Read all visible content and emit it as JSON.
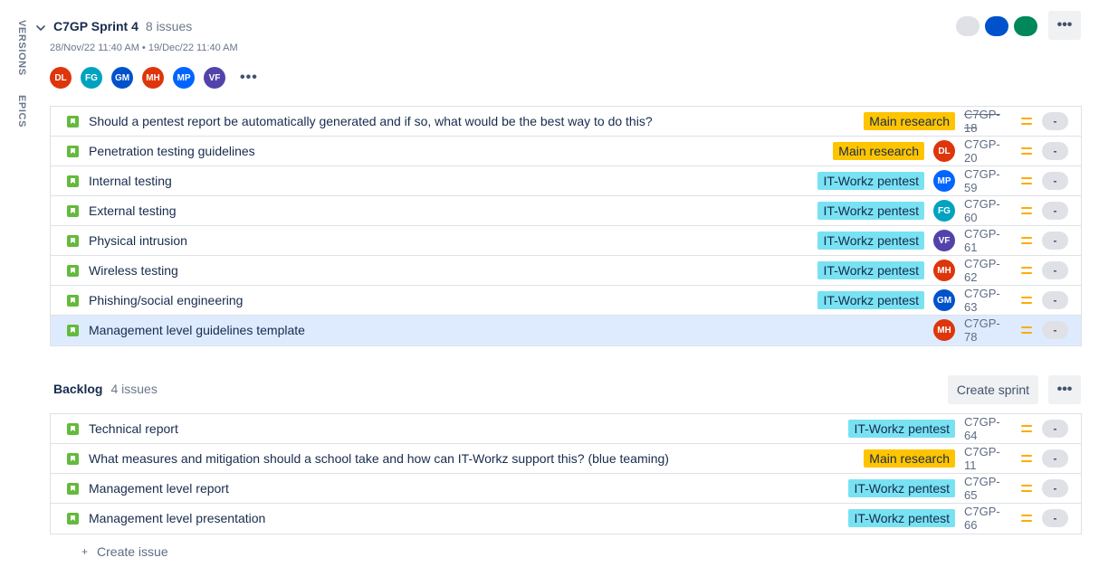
{
  "side_tabs": {
    "versions": "VERSIONS",
    "epics": "EPICS"
  },
  "sprint": {
    "title": "C7GP Sprint 4",
    "count": "8 issues",
    "dates": "28/Nov/22 11:40 AM • 19/Dec/22 11:40 AM",
    "more_label": "•••",
    "avatars": [
      {
        "initials": "DL",
        "color": "#de350b"
      },
      {
        "initials": "FG",
        "color": "#00a3bf"
      },
      {
        "initials": "GM",
        "color": "#0052cc"
      },
      {
        "initials": "MH",
        "color": "#de350b"
      },
      {
        "initials": "MP",
        "color": "#0065ff"
      },
      {
        "initials": "VF",
        "color": "#5243aa"
      }
    ],
    "status_pills": [
      "#dfe1e6",
      "#0052cc",
      "#00875a"
    ],
    "issues": [
      {
        "summary": "Should a pentest report be automatically generated and if so, what would be the best way to do this?",
        "epic": "Main research",
        "epic_color": "yellow",
        "assignee": "",
        "assignee_color": "",
        "key": "C7GP-18",
        "done": true,
        "estimate": "-"
      },
      {
        "summary": "Penetration testing guidelines",
        "epic": "Main research",
        "epic_color": "yellow",
        "assignee": "DL",
        "assignee_color": "#de350b",
        "key": "C7GP-20",
        "done": false,
        "estimate": "-"
      },
      {
        "summary": "Internal testing",
        "epic": "IT-Workz pentest",
        "epic_color": "cyan",
        "assignee": "MP",
        "assignee_color": "#0065ff",
        "key": "C7GP-59",
        "done": false,
        "estimate": "-"
      },
      {
        "summary": "External testing",
        "epic": "IT-Workz pentest",
        "epic_color": "cyan",
        "assignee": "FG",
        "assignee_color": "#00a3bf",
        "key": "C7GP-60",
        "done": false,
        "estimate": "-"
      },
      {
        "summary": "Physical intrusion",
        "epic": "IT-Workz pentest",
        "epic_color": "cyan",
        "assignee": "VF",
        "assignee_color": "#5243aa",
        "key": "C7GP-61",
        "done": false,
        "estimate": "-"
      },
      {
        "summary": "Wireless testing",
        "epic": "IT-Workz pentest",
        "epic_color": "cyan",
        "assignee": "MH",
        "assignee_color": "#de350b",
        "key": "C7GP-62",
        "done": false,
        "estimate": "-"
      },
      {
        "summary": "Phishing/social engineering",
        "epic": "IT-Workz pentest",
        "epic_color": "cyan",
        "assignee": "GM",
        "assignee_color": "#0052cc",
        "key": "C7GP-63",
        "done": false,
        "estimate": "-"
      },
      {
        "summary": "Management level guidelines template",
        "epic": "",
        "epic_color": "",
        "assignee": "MH",
        "assignee_color": "#de350b",
        "key": "C7GP-78",
        "done": false,
        "estimate": "-",
        "selected": true
      }
    ]
  },
  "backlog": {
    "title": "Backlog",
    "count": "4 issues",
    "create_sprint_label": "Create sprint",
    "more_label": "•••",
    "issues": [
      {
        "summary": "Technical report",
        "epic": "IT-Workz pentest",
        "epic_color": "cyan",
        "assignee": "",
        "assignee_color": "",
        "key": "C7GP-64",
        "done": false,
        "estimate": "-"
      },
      {
        "summary": "What measures and mitigation should a school take and how can IT-Workz support this? (blue teaming)",
        "epic": "Main research",
        "epic_color": "yellow",
        "assignee": "",
        "assignee_color": "",
        "key": "C7GP-11",
        "done": false,
        "estimate": "-"
      },
      {
        "summary": "Management level report",
        "epic": "IT-Workz pentest",
        "epic_color": "cyan",
        "assignee": "",
        "assignee_color": "",
        "key": "C7GP-65",
        "done": false,
        "estimate": "-"
      },
      {
        "summary": "Management level presentation",
        "epic": "IT-Workz pentest",
        "epic_color": "cyan",
        "assignee": "",
        "assignee_color": "",
        "key": "C7GP-66",
        "done": false,
        "estimate": "-"
      }
    ]
  },
  "create_issue": {
    "plus": "+",
    "label": "Create issue"
  }
}
